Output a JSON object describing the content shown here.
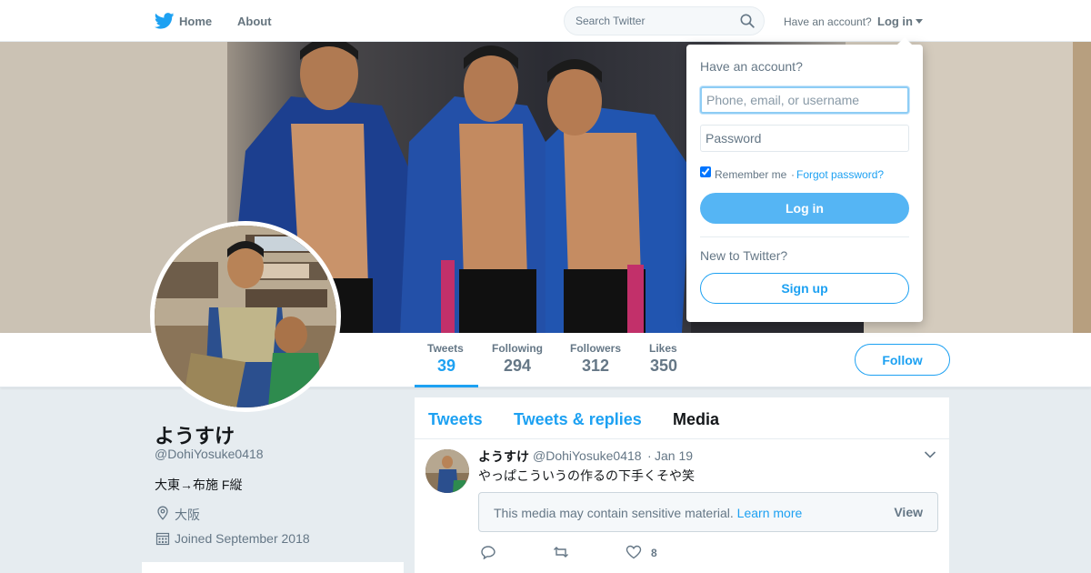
{
  "nav": {
    "logo_icon": "twitter-bird-icon",
    "home_label": "Home",
    "about_label": "About",
    "search_placeholder": "Search Twitter",
    "search_icon": "search-icon",
    "have_account_text": "Have an account?",
    "login_label": "Log in"
  },
  "profile": {
    "name": "ようすけ",
    "handle": "@DohiYosuke0418",
    "bio": "大東→布施 F縦",
    "location": "大阪",
    "joined": "Joined September 2018"
  },
  "stats": [
    {
      "label": "Tweets",
      "value": "39",
      "active": true
    },
    {
      "label": "Following",
      "value": "294",
      "active": false
    },
    {
      "label": "Followers",
      "value": "312",
      "active": false
    },
    {
      "label": "Likes",
      "value": "350",
      "active": false
    }
  ],
  "follow_label": "Follow",
  "timeline": {
    "tabs": [
      {
        "label": "Tweets",
        "current": false
      },
      {
        "label": "Tweets & replies",
        "current": false
      },
      {
        "label": "Media",
        "current": true
      }
    ],
    "tweet": {
      "name": "ようすけ",
      "handle": "@DohiYosuke0418",
      "separator": "·",
      "time": "Jan 19",
      "text": "やっぱこういうの作るの下手くそや笑",
      "sensitive_text": "This media may contain sensitive material.",
      "learn_more": "Learn more",
      "view_label": "View",
      "like_count": "8"
    }
  },
  "login_dropdown": {
    "title": "Have an account?",
    "username_placeholder": "Phone, email, or username",
    "password_placeholder": "Password",
    "remember_label": "Remember me",
    "separator": "·",
    "forgot_label": "Forgot password?",
    "login_button": "Log in",
    "new_to_text": "New to Twitter?",
    "signup_button": "Sign up"
  },
  "colors": {
    "accent": "#1da1f2",
    "muted": "#657786",
    "background": "#e6ecf0"
  }
}
